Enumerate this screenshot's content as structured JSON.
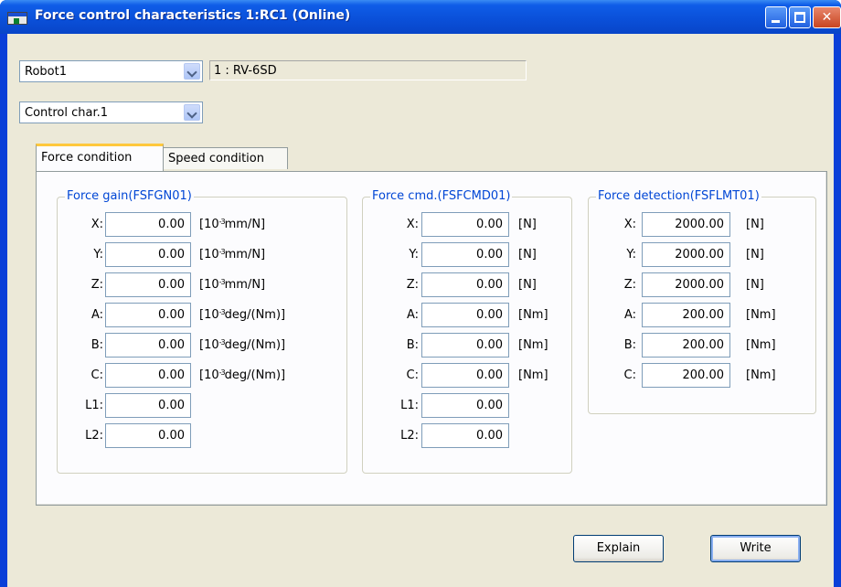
{
  "window": {
    "title": "Force control characteristics 1:RC1 (Online)"
  },
  "robot_select": {
    "value": "Robot1"
  },
  "robot_info": "1 : RV-6SD",
  "char_select": {
    "value": "Control char.1"
  },
  "tabs": [
    {
      "label": "Force condition",
      "active": true
    },
    {
      "label": "Speed condition",
      "active": false
    }
  ],
  "force_gain": {
    "legend": "Force gain(FSFGN01)",
    "rows": [
      {
        "label": "X:",
        "value": "0.00",
        "unit_pre": "[10",
        "unit_sup": "-3",
        "unit_post": "mm/N]"
      },
      {
        "label": "Y:",
        "value": "0.00",
        "unit_pre": "[10",
        "unit_sup": "-3",
        "unit_post": "mm/N]"
      },
      {
        "label": "Z:",
        "value": "0.00",
        "unit_pre": "[10",
        "unit_sup": "-3",
        "unit_post": "mm/N]"
      },
      {
        "label": "A:",
        "value": "0.00",
        "unit_pre": "[10",
        "unit_sup": "-3",
        "unit_post": "deg/(Nm)]"
      },
      {
        "label": "B:",
        "value": "0.00",
        "unit_pre": "[10",
        "unit_sup": "-3",
        "unit_post": "deg/(Nm)]"
      },
      {
        "label": "C:",
        "value": "0.00",
        "unit_pre": "[10",
        "unit_sup": "-3",
        "unit_post": "deg/(Nm)]"
      },
      {
        "label": "L1:",
        "value": "0.00"
      },
      {
        "label": "L2:",
        "value": "0.00"
      }
    ]
  },
  "force_cmd": {
    "legend": "Force cmd.(FSFCMD01)",
    "rows": [
      {
        "label": "X:",
        "value": "0.00",
        "unit": "[N]"
      },
      {
        "label": "Y:",
        "value": "0.00",
        "unit": "[N]"
      },
      {
        "label": "Z:",
        "value": "0.00",
        "unit": "[N]"
      },
      {
        "label": "A:",
        "value": "0.00",
        "unit": "[Nm]"
      },
      {
        "label": "B:",
        "value": "0.00",
        "unit": "[Nm]"
      },
      {
        "label": "C:",
        "value": "0.00",
        "unit": "[Nm]"
      },
      {
        "label": "L1:",
        "value": "0.00"
      },
      {
        "label": "L2:",
        "value": "0.00"
      }
    ]
  },
  "force_detection": {
    "legend": "Force detection(FSFLMT01)",
    "rows": [
      {
        "label": "X:",
        "value": "2000.00",
        "unit": "[N]"
      },
      {
        "label": "Y:",
        "value": "2000.00",
        "unit": "[N]"
      },
      {
        "label": "Z:",
        "value": "2000.00",
        "unit": "[N]"
      },
      {
        "label": "A:",
        "value": "200.00",
        "unit": "[Nm]"
      },
      {
        "label": "B:",
        "value": "200.00",
        "unit": "[Nm]"
      },
      {
        "label": "C:",
        "value": "200.00",
        "unit": "[Nm]"
      }
    ]
  },
  "buttons": {
    "explain": "Explain",
    "write": "Write"
  }
}
